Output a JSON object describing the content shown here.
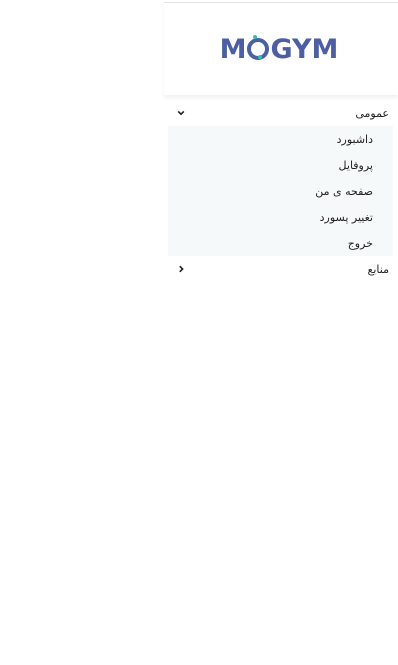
{
  "brand": {
    "logo_text": "MOGYM",
    "logo_color": "#4d5fa3",
    "dot_color": "#33c0b8"
  },
  "menu": {
    "groups": [
      {
        "label": "عمومی",
        "expanded": true,
        "icon": "chevron-down-icon",
        "items": [
          {
            "label": "داشبورد"
          },
          {
            "label": "پروفایل"
          },
          {
            "label": "صفحه ی من"
          },
          {
            "label": "تغییر پسورد"
          },
          {
            "label": "خروج"
          }
        ]
      },
      {
        "label": "منابع",
        "expanded": false,
        "icon": "chevron-left-icon"
      }
    ]
  }
}
